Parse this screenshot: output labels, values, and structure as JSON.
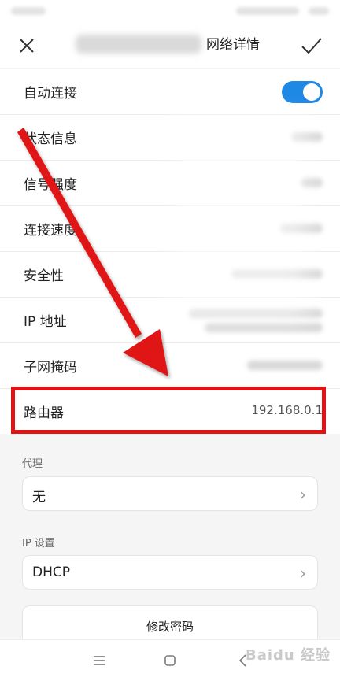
{
  "header": {
    "title": "网络详情",
    "close_icon": "close-icon",
    "confirm_icon": "check-icon"
  },
  "rows": [
    {
      "label": "自动连接",
      "type": "toggle",
      "on": true
    },
    {
      "label": "状态信息",
      "type": "blurred"
    },
    {
      "label": "信号强度",
      "type": "blurred"
    },
    {
      "label": "连接速度",
      "type": "blurred"
    },
    {
      "label": "安全性",
      "type": "blurred"
    },
    {
      "label": "IP 地址",
      "type": "blurred"
    },
    {
      "label": "子网掩码",
      "type": "blurred"
    },
    {
      "label": "路由器",
      "value": "192.168.0.1"
    }
  ],
  "proxy": {
    "section_label": "代理",
    "value": "无"
  },
  "ip_settings": {
    "section_label": "IP 设置",
    "value": "DHCP"
  },
  "modify_password_label": "修改密码",
  "nav": {
    "menu_icon": "menu-icon",
    "home_icon": "home-icon",
    "back_icon": "back-icon"
  },
  "watermark": "Baidu 经验",
  "colors": {
    "accent": "#1e88e5",
    "highlight": "#e01414",
    "arrow": "#e01414"
  }
}
